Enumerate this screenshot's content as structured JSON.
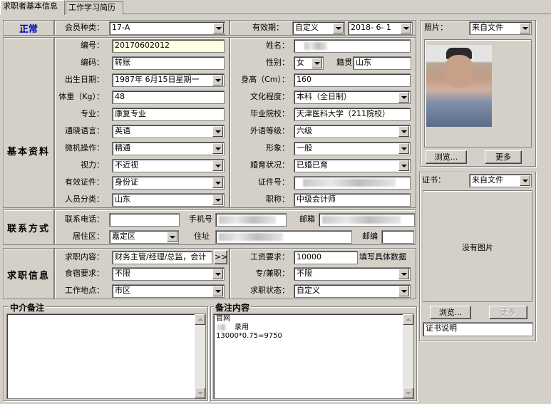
{
  "tabs": [
    "求职者基本信息",
    "工作学习简历"
  ],
  "status": "正常",
  "member_type": {
    "label": "会员种类：",
    "value": "17-A"
  },
  "validity": {
    "label": "有效期：",
    "mode": "自定义",
    "date": "2018- 6- 1"
  },
  "sections": {
    "basic": "基本资料",
    "contact": "联系方式",
    "job": "求职信息"
  },
  "basic": {
    "id_label": "编号：",
    "id_value": "20170602012",
    "name_label": "姓名：",
    "code_label": "编码：",
    "code_value": "转账",
    "gender_label": "性别：",
    "gender_value": "女",
    "native_label": "籍贯",
    "native_value": "山东",
    "birth_label": "出生日期：",
    "birth_value": "1987年 6月15日星期一",
    "height_label": "身高（Cm）：",
    "height_value": "160",
    "weight_label": "体重（Kg）：",
    "weight_value": "48",
    "edu_label": "文化程度：",
    "edu_value": "本科（全日制）",
    "major_label": "专业：",
    "major_value": "康复专业",
    "school_label": "毕业院校：",
    "school_value": "天津医科大学（211院校）",
    "lang_label": "通晓语言：",
    "lang_value": "英语",
    "lang_level_label": "外语等级：",
    "lang_level_value": "六级",
    "pc_label": "微机操作：",
    "pc_value": "精通",
    "image_label": "形象：",
    "image_value": "一般",
    "sight_label": "视力：",
    "sight_value": "不近视",
    "marriage_label": "婚育状况：",
    "marriage_value": "已婚已育",
    "idtype_label": "有效证件：",
    "idtype_value": "身份证",
    "idno_label": "证件号：",
    "category_label": "人员分类：",
    "category_value": "山东",
    "title_label": "职称：",
    "title_value": "中级会计师"
  },
  "contact": {
    "phone_label": "联系电话：",
    "mobile_label": "手机号",
    "email_label": "邮箱",
    "district_label": "居住区：",
    "district_value": "嘉定区",
    "address_label": "住址",
    "zip_label": "邮编"
  },
  "job": {
    "content_label": "求职内容：",
    "content_value": "财务主管/经理/总监，会计",
    "more_btn": ">>",
    "salary_label": "工资要求：",
    "salary_value": "10000",
    "salary_hint": "填写具体数据",
    "board_label": "食宿要求：",
    "board_value": "不限",
    "parttime_label": "专/兼职：",
    "parttime_value": "不限",
    "location_label": "工作地点：",
    "location_value": "市区",
    "state_label": "求职状态：",
    "state_value": "自定义"
  },
  "notes": {
    "agent_title": "中介备注",
    "remark_title": "备注内容",
    "remark_lines": [
      "官网",
      "录用",
      "13000*0.75=9750"
    ]
  },
  "photo": {
    "label": "照片：",
    "source": "来自文件",
    "browse": "浏览...",
    "more": "更多"
  },
  "cert": {
    "label": "证书：",
    "source": "来自文件",
    "empty": "没有图片",
    "browse": "浏览...",
    "more": "更多",
    "desc": "证书说明"
  }
}
